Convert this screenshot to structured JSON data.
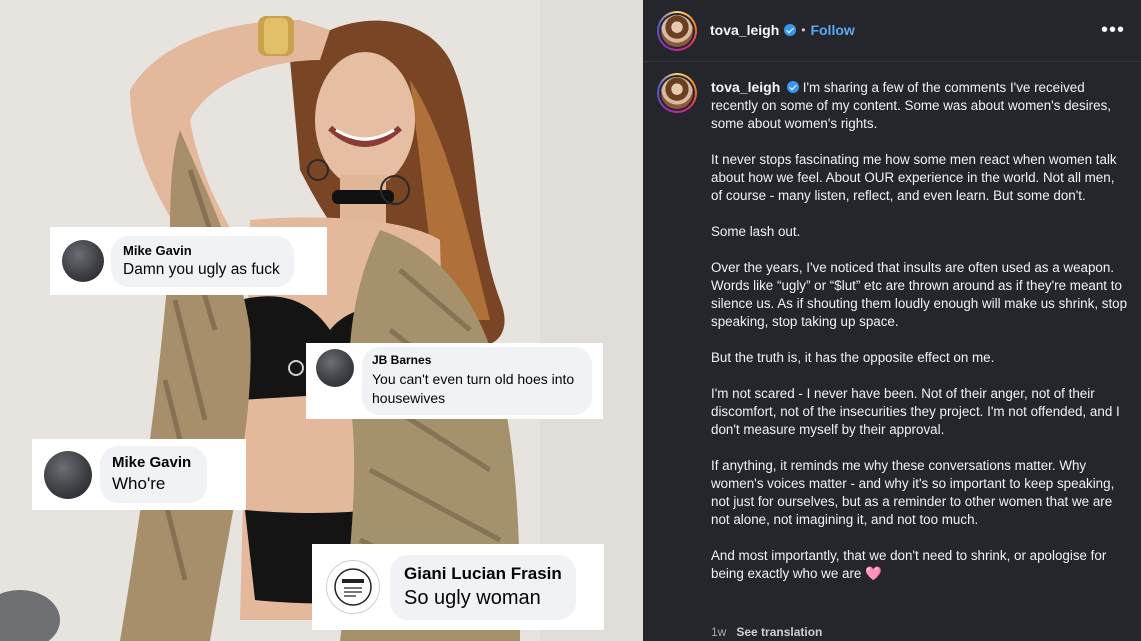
{
  "comments": [
    {
      "name": "Mike Gavin",
      "text": "Damn you ugly as fuck"
    },
    {
      "name": "JB Barnes",
      "text": "You can't even turn old hoes into housewives"
    },
    {
      "name": "Mike Gavin",
      "text": "Who're"
    },
    {
      "name": "Giani Lucian Frasin",
      "text": "So ugly woman"
    }
  ],
  "post": {
    "username": "tova_leigh",
    "follow_label": "Follow",
    "more_icon": "more-horizontal-icon",
    "caption_paragraphs": [
      "I'm sharing a few of the comments I've received recently on some of my content. Some was about women's desires, some about women's rights.",
      "It never stops fascinating me how some men react when women talk about how we feel. About OUR experience in the world. Not all men, of course - many listen, reflect, and even learn. But some don't.",
      "Some lash out.",
      "Over the years, I've noticed that insults are often used as a weapon. Words like “ugly” or “$lut” etc are thrown around as if they're meant to silence us. As if shouting them loudly enough will make us shrink, stop speaking, stop taking up space.",
      "But the truth is, it has the opposite effect on me.",
      "I'm not scared - I never have been. Not of their anger, not of their discomfort, not of the insecurities they project. I'm not offended, and I don't measure myself by their approval.",
      "If anything, it reminds me why these conversations matter. Why women's voices matter - and why it's so important to keep speaking, not just for ourselves, but as a reminder to other women that we are not alone, not imagining it, and not too much.",
      "And most importantly, that we don't need to shrink, or apologise for being exactly who we are"
    ],
    "heart_emoji": "🩷",
    "time_ago": "1w",
    "see_translation": "See translation"
  },
  "colors": {
    "panel_bg": "#25262b",
    "link_blue": "#5aa9f7",
    "verified_blue": "#3897f0"
  }
}
